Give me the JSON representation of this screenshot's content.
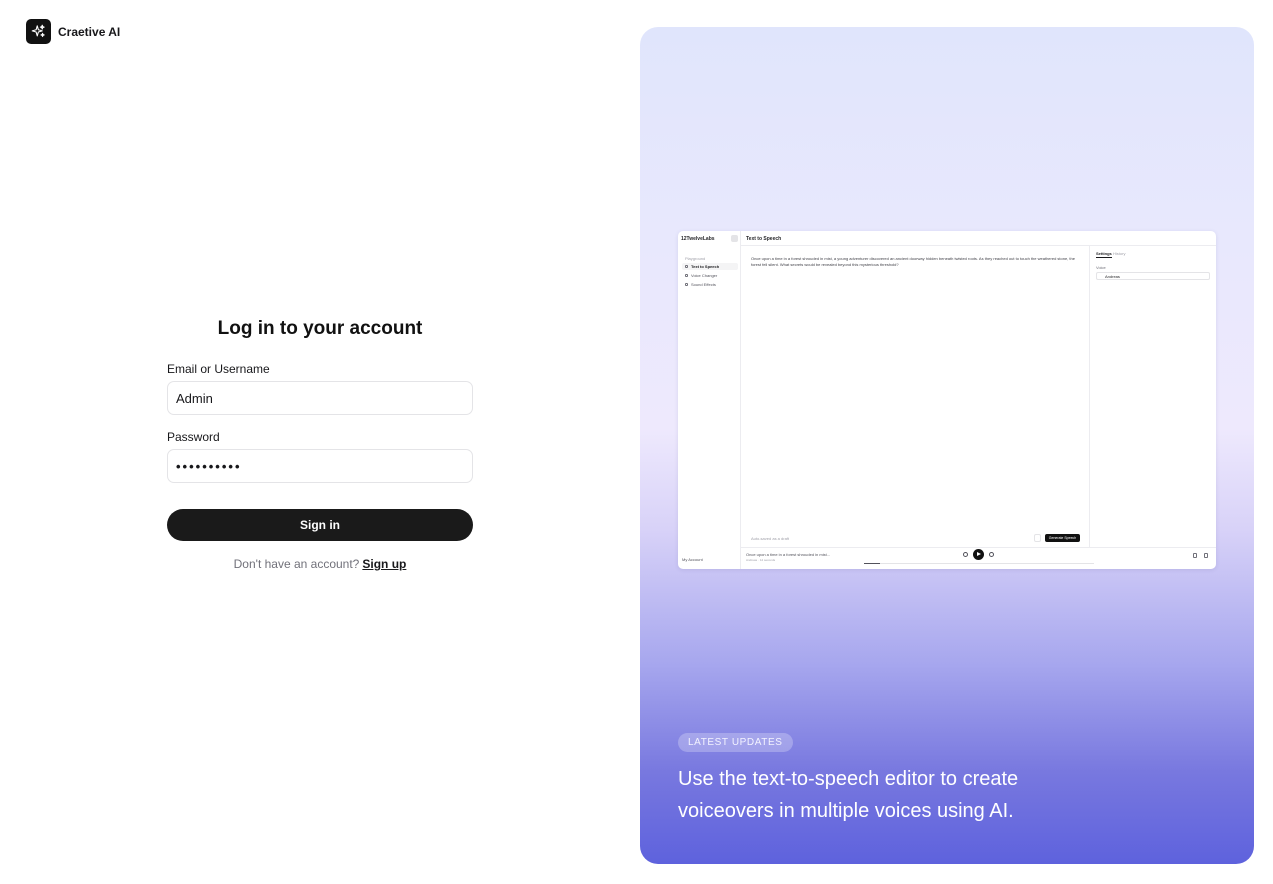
{
  "brand": {
    "name": "Craetive AI",
    "logo_icon": "sparkles-icon"
  },
  "login": {
    "title": "Log in to your account",
    "email_label": "Email or Username",
    "email_value": "Admin",
    "password_label": "Password",
    "password_value": "••••••••••",
    "signin_label": "Sign in",
    "signup_prompt": "Don't have an account?",
    "signup_link": "Sign up"
  },
  "mock": {
    "app_name": "12TwelveLabs",
    "nav_header": "Playground",
    "nav": [
      "Text to Speech",
      "Voice Changer",
      "Sound Effects"
    ],
    "account": "My Account",
    "page_title": "Text to Speech",
    "body_text": "Once upon a time in a forest shrouded in mist, a young adventurer discovered an ancient doorway hidden beneath twisted roots. As they reached out to touch the weathered stone, the forest fell silent. What secrets would be revealed beyond this mysterious threshold?",
    "hint": "Auto-saved as a draft",
    "generate_label": "Generate Speech",
    "settings_tab": "Settings",
    "history_tab": "History",
    "voice_label": "Voice",
    "voice_value": "Andreas",
    "player_text": "Once upon a time in a forest shrouded in mist...",
    "player_sub": "Andreas · 12 seconds"
  },
  "promo": {
    "badge": "LATEST UPDATES",
    "headline": "Use the text-to-speech editor to create voiceovers in multiple voices using AI."
  },
  "colors": {
    "primary_button": "#1a1a1a",
    "panel_top": "#e0e5fc",
    "panel_bottom": "#5e62dd"
  }
}
